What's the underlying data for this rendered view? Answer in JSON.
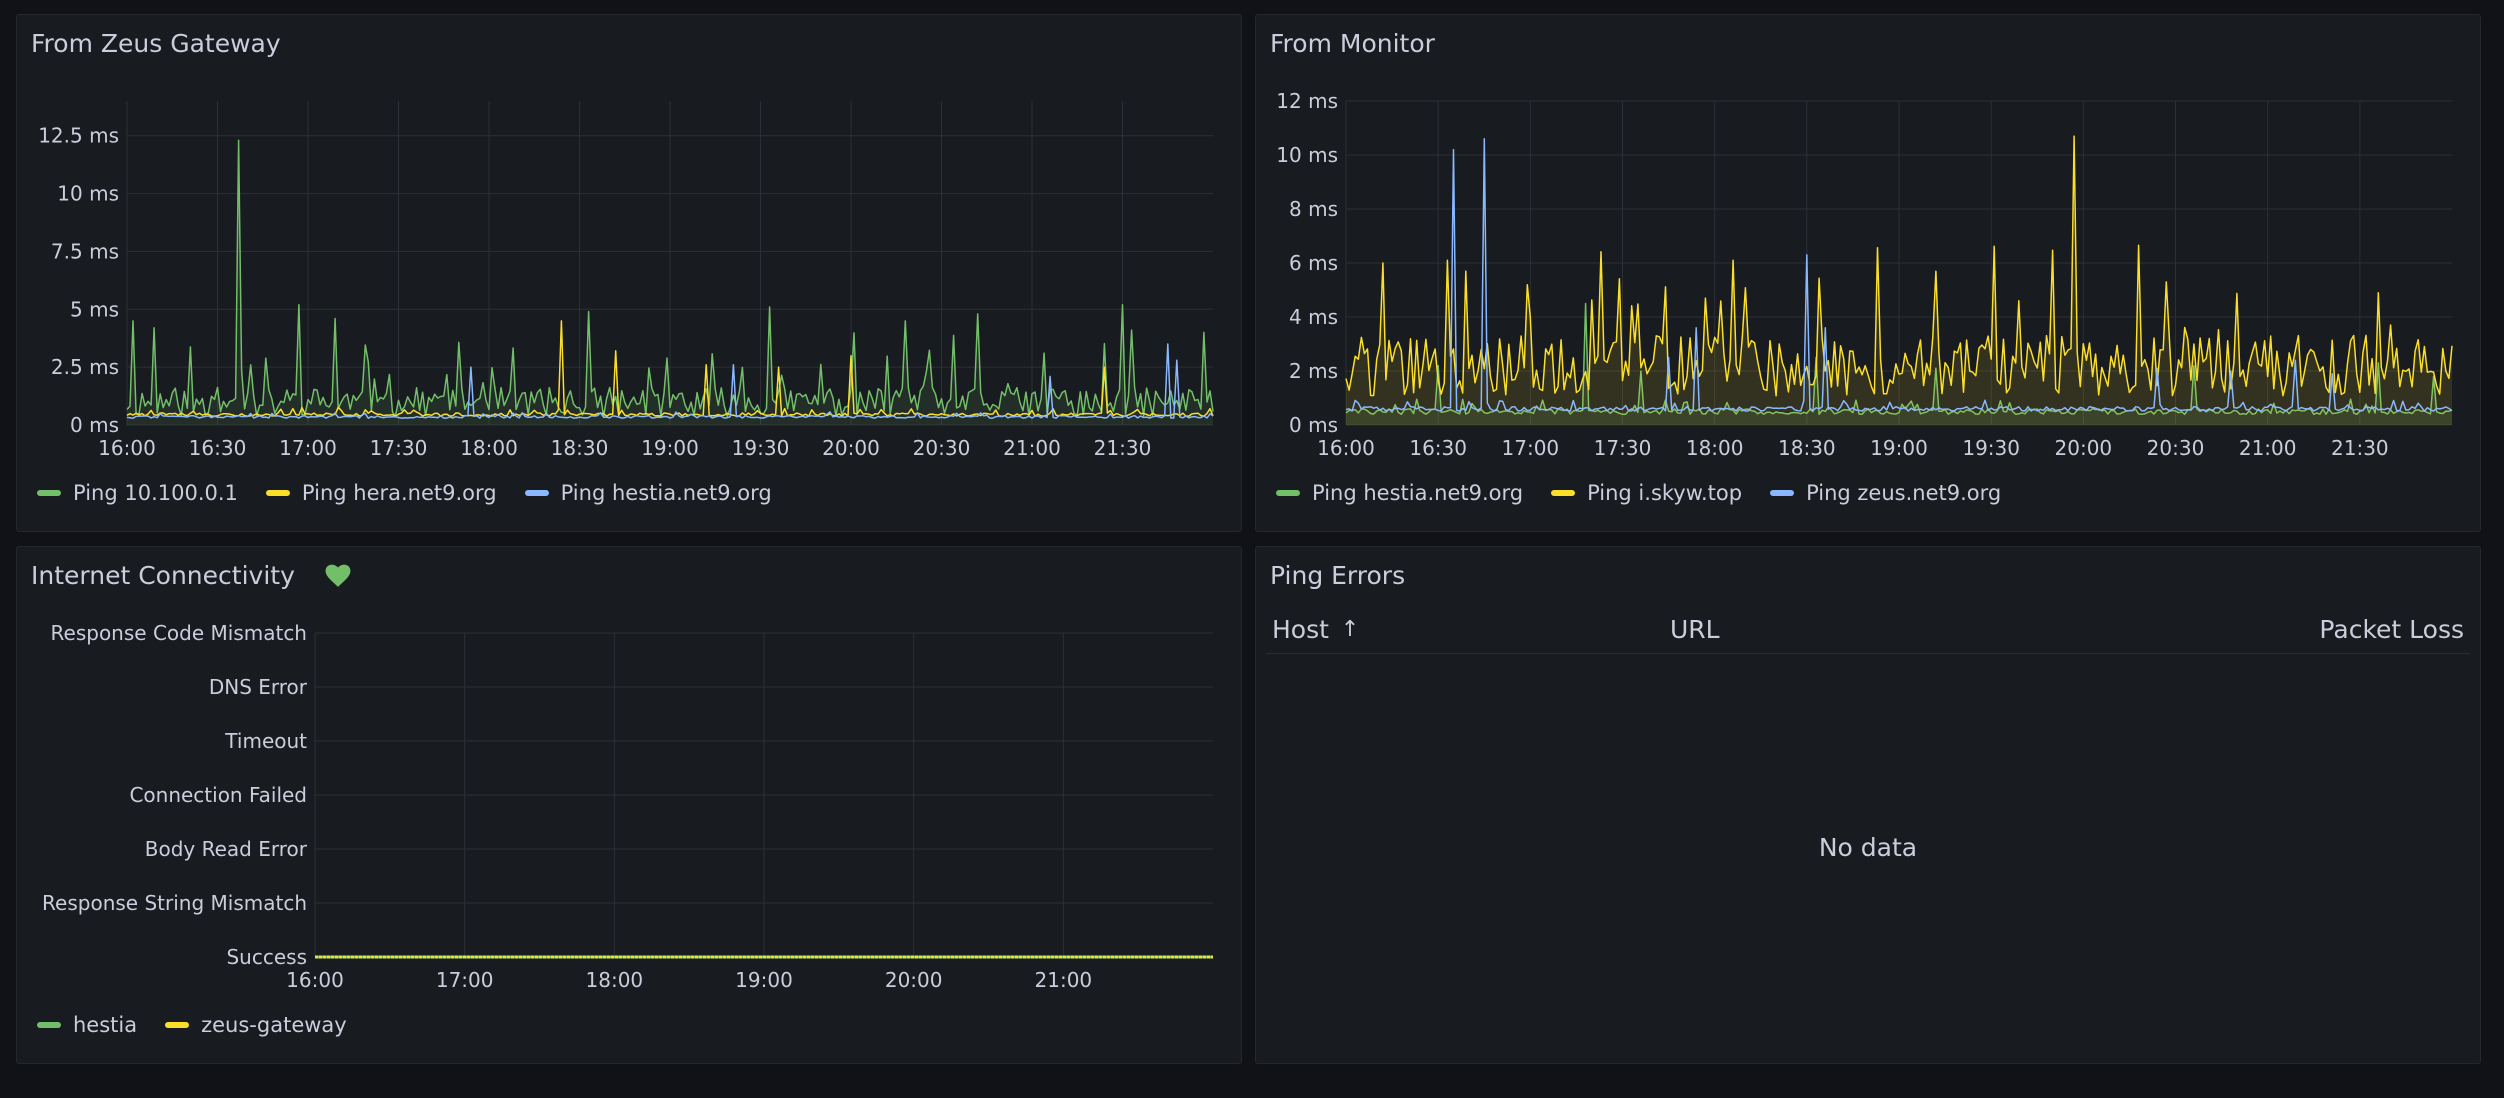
{
  "colors": {
    "background": "#111217",
    "panel": "#181b1f",
    "grid": "#2c2f36",
    "axis_text": "#ccccdc",
    "green": "#73bf69",
    "yellow": "#fade2a",
    "blue": "#8ab8ff"
  },
  "panels": {
    "zeus_gateway": {
      "title": "From Zeus Gateway",
      "legend": [
        {
          "label": "Ping 10.100.0.1",
          "color": "#73bf69"
        },
        {
          "label": "Ping hera.net9.org",
          "color": "#fade2a"
        },
        {
          "label": "Ping hestia.net9.org",
          "color": "#8ab8ff"
        }
      ]
    },
    "monitor": {
      "title": "From Monitor",
      "legend": [
        {
          "label": "Ping hestia.net9.org",
          "color": "#73bf69"
        },
        {
          "label": "Ping i.skyw.top",
          "color": "#fade2a"
        },
        {
          "label": "Ping zeus.net9.org",
          "color": "#8ab8ff"
        }
      ]
    },
    "connectivity": {
      "title": "Internet Connectivity",
      "status_icon": "heart-icon",
      "legend": [
        {
          "label": "hestia",
          "color": "#73bf69"
        },
        {
          "label": "zeus-gateway",
          "color": "#fade2a"
        }
      ]
    },
    "ping_errors": {
      "title": "Ping Errors",
      "columns": [
        "Host",
        "URL",
        "Packet Loss"
      ],
      "sort_indicator": "↑",
      "empty_text": "No data"
    }
  },
  "chart_data": [
    {
      "id": "zeus_gateway",
      "type": "line",
      "title": "From Zeus Gateway",
      "x_range": [
        "16:00",
        "22:00"
      ],
      "x_ticks": [
        "16:00",
        "16:30",
        "17:00",
        "17:30",
        "18:00",
        "18:30",
        "19:00",
        "19:30",
        "20:00",
        "20:30",
        "21:00",
        "21:30"
      ],
      "y_ticks": [
        "0 ms",
        "2.5 ms",
        "5 ms",
        "7.5 ms",
        "10 ms",
        "12.5 ms"
      ],
      "y_tick_values": [
        0,
        2.5,
        5,
        7.5,
        10,
        12.5
      ],
      "ylim": [
        0,
        14
      ],
      "grid": true,
      "legend_placement": "bottom-left",
      "series": [
        {
          "name": "Ping 10.100.0.1",
          "color": "#73bf69",
          "fill": true,
          "baseline": 1.0,
          "noise": 0.9,
          "spikes": [
            [
              16.03,
              4.5
            ],
            [
              16.15,
              4.2
            ],
            [
              16.62,
              12.3
            ],
            [
              16.95,
              5.2
            ],
            [
              17.15,
              4.6
            ],
            [
              18.55,
              4.9
            ],
            [
              19.55,
              5.1
            ],
            [
              20.3,
              4.5
            ],
            [
              20.7,
              4.8
            ],
            [
              21.5,
              5.2
            ],
            [
              21.55,
              4.1
            ],
            [
              21.95,
              4.0
            ]
          ]
        },
        {
          "name": "Ping hera.net9.org",
          "color": "#fade2a",
          "fill": false,
          "baseline": 0.45,
          "noise": 0.1,
          "spikes": [
            [
              18.4,
              4.5
            ],
            [
              18.7,
              3.2
            ],
            [
              19.2,
              2.6
            ],
            [
              19.6,
              2.5
            ],
            [
              20.0,
              3.0
            ],
            [
              21.4,
              2.5
            ]
          ]
        },
        {
          "name": "Ping hestia.net9.org",
          "color": "#8ab8ff",
          "fill": false,
          "baseline": 0.35,
          "noise": 0.08,
          "spikes": [
            [
              17.9,
              2.5
            ],
            [
              19.35,
              2.6
            ],
            [
              21.1,
              2.1
            ],
            [
              21.75,
              3.5
            ],
            [
              21.8,
              2.8
            ]
          ]
        }
      ]
    },
    {
      "id": "monitor",
      "type": "line",
      "title": "From Monitor",
      "x_range": [
        "16:00",
        "22:00"
      ],
      "x_ticks": [
        "16:00",
        "16:30",
        "17:00",
        "17:30",
        "18:00",
        "18:30",
        "19:00",
        "19:30",
        "20:00",
        "20:30",
        "21:00",
        "21:30"
      ],
      "y_ticks": [
        "0 ms",
        "2 ms",
        "4 ms",
        "6 ms",
        "8 ms",
        "10 ms",
        "12 ms"
      ],
      "y_tick_values": [
        0,
        2,
        4,
        6,
        8,
        10,
        12
      ],
      "ylim": [
        0,
        12
      ],
      "grid": true,
      "legend_placement": "bottom-left",
      "series": [
        {
          "name": "Ping hestia.net9.org",
          "color": "#73bf69",
          "fill": true,
          "baseline": 0.5,
          "noise": 0.15,
          "spikes": [
            [
              16.5,
              2.2
            ],
            [
              17.3,
              4.5
            ],
            [
              17.6,
              2.0
            ],
            [
              18.55,
              2.5
            ],
            [
              19.2,
              2.1
            ],
            [
              20.6,
              2.2
            ],
            [
              21.6,
              2.3
            ],
            [
              21.9,
              1.8
            ]
          ]
        },
        {
          "name": "Ping i.skyw.top",
          "color": "#fade2a",
          "fill": true,
          "baseline": 2.2,
          "noise": 1.6,
          "spikes": [
            [
              16.55,
              6.1
            ],
            [
              16.65,
              5.7
            ],
            [
              17.0,
              4.0
            ],
            [
              17.95,
              4.7
            ],
            [
              18.1,
              6.1
            ],
            [
              19.65,
              4.6
            ],
            [
              19.95,
              10.7
            ],
            [
              20.45,
              5.3
            ],
            [
              21.6,
              4.9
            ]
          ]
        },
        {
          "name": "Ping zeus.net9.org",
          "color": "#8ab8ff",
          "fill": false,
          "baseline": 0.6,
          "noise": 0.12,
          "spikes": [
            [
              16.58,
              10.2
            ],
            [
              16.75,
              10.6
            ],
            [
              17.75,
              2.5
            ],
            [
              17.9,
              3.6
            ],
            [
              18.5,
              6.3
            ],
            [
              18.6,
              3.6
            ],
            [
              20.4,
              2.1
            ],
            [
              20.8,
              2.0
            ],
            [
              21.15,
              2.4
            ],
            [
              21.35,
              1.9
            ]
          ]
        }
      ]
    },
    {
      "id": "connectivity",
      "type": "line",
      "title": "Internet Connectivity",
      "x_range": [
        "16:00",
        "22:00"
      ],
      "x_ticks": [
        "16:00",
        "17:00",
        "18:00",
        "19:00",
        "20:00",
        "21:00"
      ],
      "y_categories": [
        "Success",
        "Response String Mismatch",
        "Body Read Error",
        "Connection Failed",
        "Timeout",
        "DNS Error",
        "Response Code Mismatch"
      ],
      "grid": true,
      "legend_placement": "bottom-left",
      "series": [
        {
          "name": "hestia",
          "color": "#73bf69",
          "state": "Success"
        },
        {
          "name": "zeus-gateway",
          "color": "#fade2a",
          "state": "Success"
        }
      ]
    }
  ]
}
